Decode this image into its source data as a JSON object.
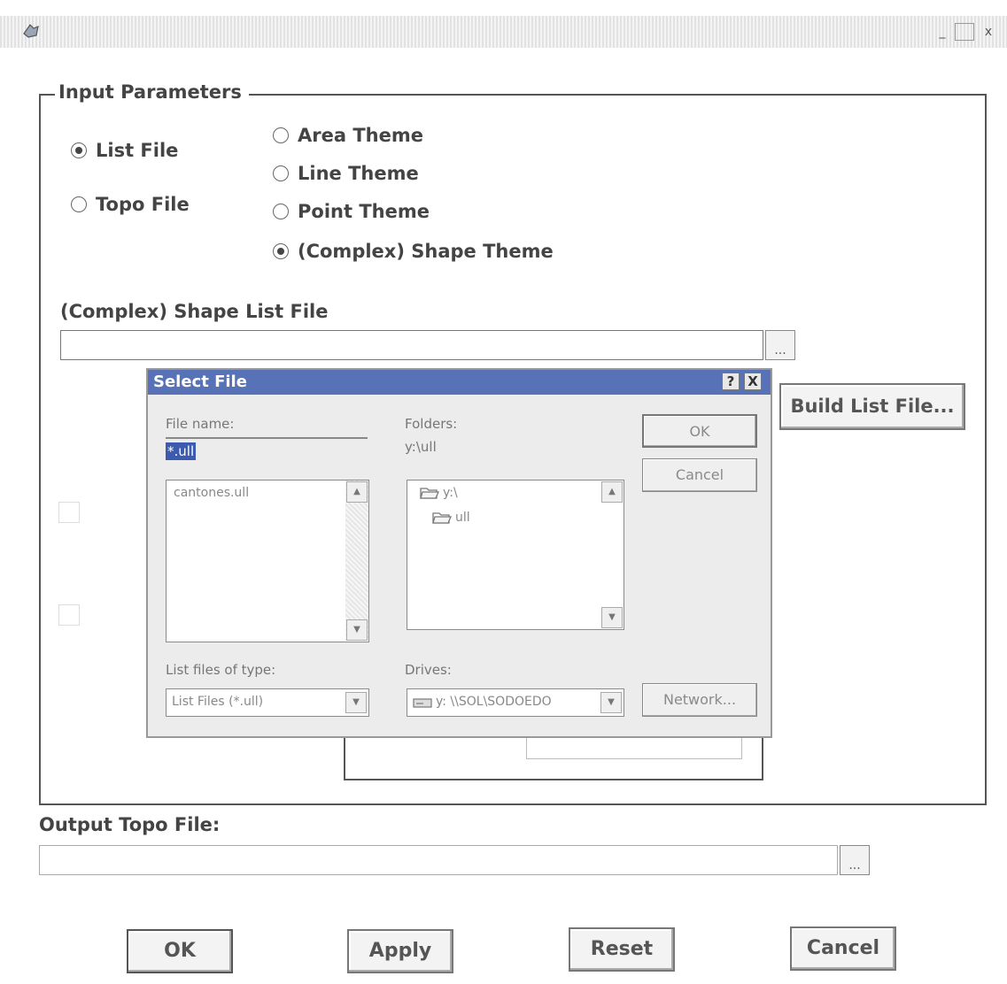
{
  "window": {
    "minimize_glyph": "_",
    "maximize_glyph": "□",
    "close_glyph": "x"
  },
  "input_parameters": {
    "legend": "Input Parameters",
    "source_options": [
      {
        "label": "List File",
        "selected": true
      },
      {
        "label": "Topo File",
        "selected": false
      }
    ],
    "theme_options": [
      {
        "label": "Area Theme",
        "selected": false
      },
      {
        "label": "Line Theme",
        "selected": false
      },
      {
        "label": "Point Theme",
        "selected": false
      },
      {
        "label": "(Complex) Shape Theme",
        "selected": true
      }
    ],
    "list_file_label": "(Complex) Shape List File",
    "list_file_value": "",
    "browse_label": "...",
    "build_list_label": "Build List File..."
  },
  "select_file_dialog": {
    "title": "Select File",
    "help_glyph": "?",
    "close_glyph": "X",
    "file_name_label": "File name:",
    "file_name_value": "*.ull",
    "files": [
      "cantones.ull"
    ],
    "folders_label": "Folders:",
    "current_folder": "y:\\ull",
    "folder_tree": [
      "y:\\",
      "ull"
    ],
    "file_type_label": "List files of type:",
    "file_type_value": "List Files (*.ull)",
    "drives_label": "Drives:",
    "drive_value": "y: \\\\SOL\\SODOEDO",
    "ok_label": "OK",
    "cancel_label": "Cancel",
    "network_label": "Network..."
  },
  "output": {
    "label": "Output Topo File:",
    "value": "",
    "browse_label": "..."
  },
  "buttons": {
    "ok": "OK",
    "apply": "Apply",
    "reset": "Reset",
    "cancel": "Cancel"
  },
  "colors": {
    "dialog_title_bar": "#5872b8",
    "selection_highlight": "#3b5bb0"
  }
}
